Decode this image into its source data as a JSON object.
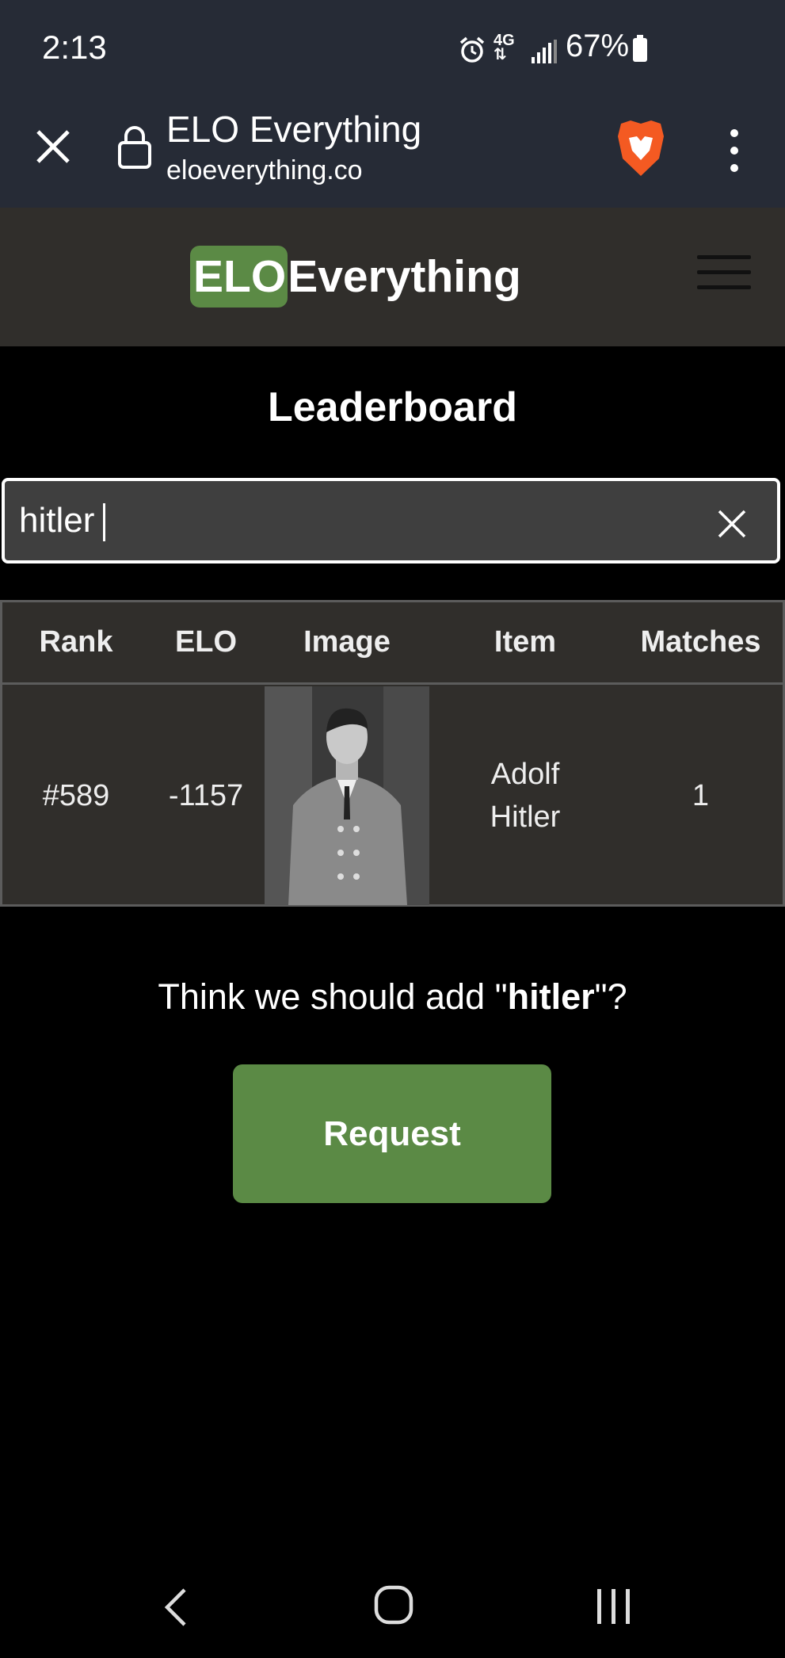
{
  "status_bar": {
    "time": "2:13",
    "network": "4G",
    "battery": "67%",
    "icons": [
      "alarm-icon",
      "network-4g-icon",
      "signal-icon",
      "battery-icon"
    ]
  },
  "browser": {
    "tab_title": "ELO Everything",
    "url": "eloeverything.co",
    "icons": [
      "close-icon",
      "lock-icon",
      "brave-shield-icon",
      "more-vert-icon"
    ]
  },
  "site": {
    "logo_elo": "ELO",
    "logo_rest": "Everything",
    "menu_icon": "hamburger-icon",
    "brand_color": "#5b8a45"
  },
  "main": {
    "title": "Leaderboard",
    "search": {
      "value": "hitler",
      "clear_icon": "close-icon"
    },
    "table": {
      "headers": [
        "Rank",
        "ELO",
        "Image",
        "Item",
        "Matches"
      ],
      "rows": [
        {
          "rank": "#589",
          "elo": "-1157",
          "item": "Adolf Hitler",
          "matches": "1"
        }
      ]
    },
    "request": {
      "prefix": "Think we should add \"",
      "term": "hitler",
      "suffix": "\"?",
      "button_label": "Request"
    }
  },
  "nav": {
    "icons": [
      "back-icon",
      "home-icon",
      "recents-icon"
    ]
  }
}
